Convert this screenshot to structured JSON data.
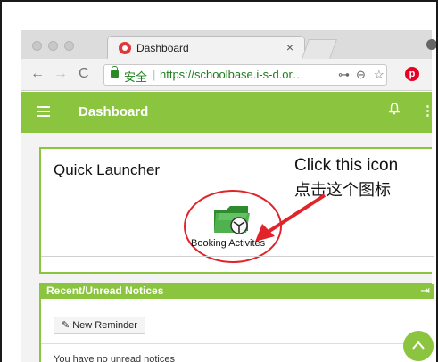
{
  "browser": {
    "tab_title": "Dashboard",
    "tab_close": "×",
    "secure_label": "安全",
    "url": "https://schoolbase.i-s-d.or…",
    "nav": {
      "back": "←",
      "forward": "→",
      "reload": "C"
    },
    "omnibox_icons": {
      "key": "⊶",
      "zoom": "⊖",
      "star": "☆"
    },
    "extension": "p"
  },
  "appbar": {
    "title": "Dashboard",
    "bell": "🔔",
    "menu": "⋮"
  },
  "quick_launcher": {
    "title": "Quick Launcher",
    "annotation_en": "Click this icon",
    "annotation_cn": "点击这个图标",
    "item_label": "Booking Activites"
  },
  "notices": {
    "title": "Recent/Unread Notices",
    "exit_icon": "⇥",
    "reminder_button": "New Reminder",
    "empty_message": "You have no unread notices"
  },
  "colors": {
    "accent": "#8bc53f",
    "annotation": "#e0242a",
    "secure": "#1e7e1e"
  }
}
